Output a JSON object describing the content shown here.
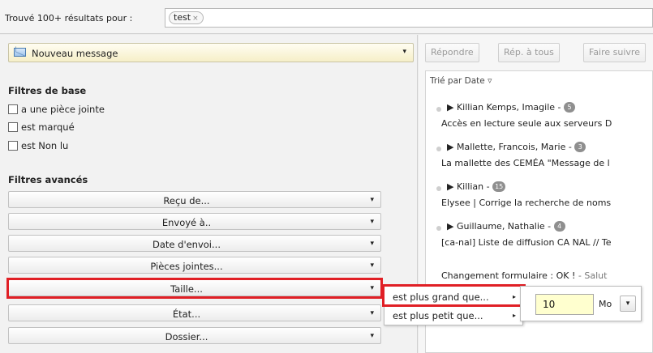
{
  "search": {
    "results_label": "Trouvé 100+ résultats pour :",
    "token": "test",
    "token_close": "×"
  },
  "compose": {
    "label": "Nouveau message",
    "caret": "▾"
  },
  "basic_filters": {
    "title": "Filtres de base",
    "items": [
      {
        "label": "a une pièce jointe",
        "checked": false
      },
      {
        "label": "est marqué",
        "checked": false
      },
      {
        "label": "est Non lu",
        "checked": false
      }
    ]
  },
  "advanced_filters": {
    "title": "Filtres avancés",
    "items": [
      {
        "label": "Reçu de..."
      },
      {
        "label": "Envoyé à.."
      },
      {
        "label": "Date d'envoi..."
      },
      {
        "label": "Pièces jointes..."
      },
      {
        "label": "Taille..."
      },
      {
        "label": "État..."
      },
      {
        "label": "Dossier..."
      }
    ],
    "caret": "▾"
  },
  "size_submenu": {
    "items": [
      "est plus grand que...",
      "est plus petit que..."
    ],
    "arrow": "▸",
    "value": "10",
    "unit": "Mo",
    "unit_caret": "▾"
  },
  "toolbar": {
    "reply": "Répondre",
    "reply_all": "Rép. à tous",
    "forward": "Faire suivre"
  },
  "message_list": {
    "sort_label": "Trié par Date ▿",
    "messages": [
      {
        "sender": "▶ Killian Kemps, Imagile -",
        "count": "5",
        "subject": "Accès en lecture seule aux serveurs D",
        "snippet": ""
      },
      {
        "sender": "▶ Mallette, Francois, Marie -",
        "count": "3",
        "subject": "La mallette des CEMÉA \"Message de l",
        "snippet": ""
      },
      {
        "sender": "▶ Killian -",
        "count": "15",
        "subject": "Elysee | Corrige la recherche de noms",
        "snippet": ""
      },
      {
        "sender": "▶ Guillaume, Nathalie -",
        "count": "4",
        "subject": "[ca-nal] Liste de diffusion CA NAL // Te",
        "snippet": ""
      },
      {
        "sender": "",
        "count": "",
        "subject": "Changement formulaire : OK !",
        "snippet": " - Salut"
      }
    ]
  },
  "colors": {
    "highlight": "#e01f25",
    "input_bg": "#ffffcf",
    "compose_bg": "#f6efc8"
  }
}
